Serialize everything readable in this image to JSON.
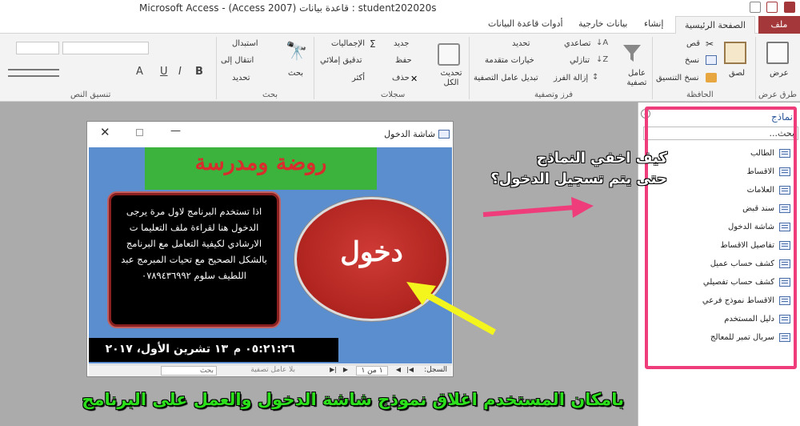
{
  "window": {
    "title": "Microsoft Access - (Access 2007) قاعدة بيانات : student202020s"
  },
  "tabs": {
    "file": "ملف",
    "home": "الصفحة الرئيسية",
    "create": "إنشاء",
    "external": "بيانات خارجية",
    "db_tools": "أدوات قاعدة البيانات"
  },
  "ribbon": {
    "views": {
      "view": "عرض",
      "group": "طرق عرض"
    },
    "clipboard": {
      "paste": "لصق",
      "cut": "قص",
      "copy": "نسخ",
      "format_painter": "نسخ التنسيق",
      "group": "الحافظة"
    },
    "sort_filter": {
      "filter": "عامل تصفية",
      "ascending": "تصاعدي",
      "descending": "تنازلي",
      "remove_sort": "إزالة الفرز",
      "selection": "تحديد",
      "advanced": "خيارات متقدمة",
      "toggle_filter": "تبديل عامل التصفية",
      "group": "فرز وتصفية"
    },
    "records": {
      "refresh": "تحديث الكل",
      "new": "جديد",
      "save": "حفظ",
      "delete": "حذف",
      "totals": "الإجماليات",
      "spelling": "تدقيق إملائي",
      "more": "أكثر",
      "group": "سجلات"
    },
    "find": {
      "find": "بحث",
      "replace": "استبدال",
      "goto": "انتقال إلى",
      "select": "تحديد",
      "group": "بحث"
    },
    "text_format": {
      "group": "تنسيق النص",
      "bold": "B",
      "italic": "I",
      "underline": "U",
      "font_color": "A"
    }
  },
  "nav": {
    "title": "نماذج",
    "search_placeholder": "بحث...",
    "items": [
      "الطالب",
      "الاقساط",
      "العلامات",
      "سند قبض",
      "شاشة الدخول",
      "تفاصيل الاقساط",
      "كشف حساب عميل",
      "كشف حساب تفصيلي",
      "الاقساط نموذج فرعي",
      "دليل المستخدم",
      "سربال تمبر للمعالج"
    ]
  },
  "form": {
    "title": "شاشة الدخول",
    "banner": "روضة ومدرسة",
    "note": "اذا تستخدم البرنامج لاول مرة يرجى الدخول هنا لقراءة ملف التعليما ت الارشادي لكيفية التعامل مع البرنامج بالشكل الصحيح  مع تحيات المبرمج عبد اللطيف سلوم ٠٧٨٩٤٣٦٩٩٢",
    "enter_button": "دخول",
    "date": "١٣ تشرين الأول، ٢٠١٧",
    "time": "٠٥:٢١:٢٦ م",
    "record_label": "السجل:",
    "record_position": "١ من ١",
    "no_filter": "بلا عامل تصفية",
    "search": "بحث"
  },
  "annotations": {
    "question_line1": "كيف اخفي النماذج",
    "question_line2": "حتى يتم تسجيل الدخول؟",
    "bottom": "بامكان المستخدم اغلاق نموذج شاشة الدخول والعمل على البرنامج"
  },
  "colors": {
    "highlight_box": "#ef3d7b",
    "arrow_pink": "#ef3d7b",
    "arrow_yellow": "#f5f51e",
    "banner_green": "#3cb33c",
    "banner_text": "#d82d2d",
    "form_bg": "#5b8ecf",
    "bottom_text": "#2be01b"
  }
}
